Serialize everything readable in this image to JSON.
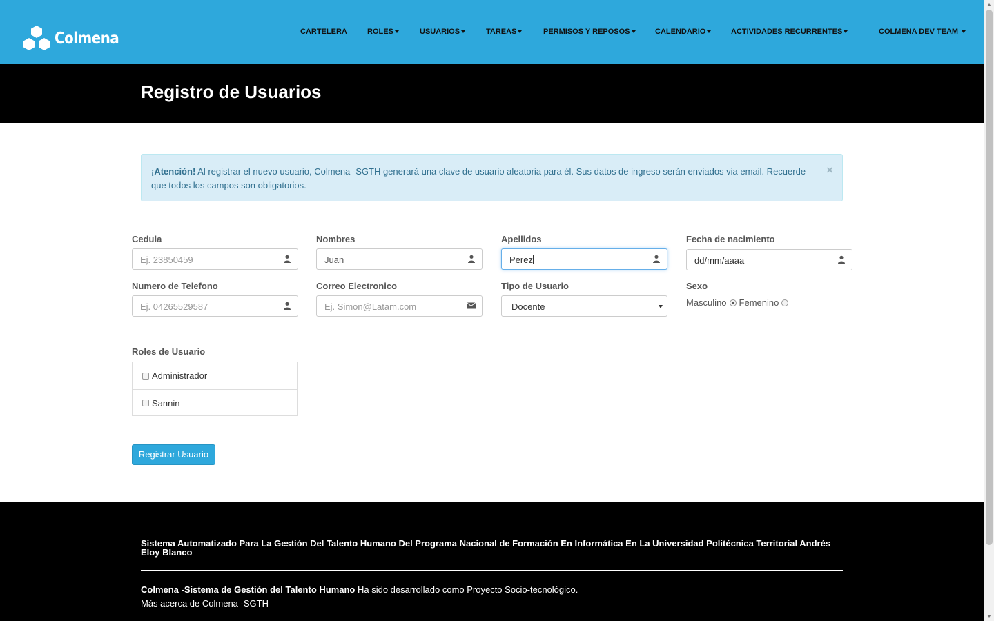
{
  "brand": {
    "name": "Colmena"
  },
  "nav": {
    "items": [
      {
        "label": "CARTELERA",
        "dropdown": false
      },
      {
        "label": "ROLES",
        "dropdown": true
      },
      {
        "label": "USUARIOS",
        "dropdown": true
      },
      {
        "label": "TAREAS",
        "dropdown": true
      },
      {
        "label": "PERMISOS Y REPOSOS",
        "dropdown": true
      },
      {
        "label": "CALENDARIO",
        "dropdown": true
      },
      {
        "label": "ACTIVIDADES RECURRENTES",
        "dropdown": true
      }
    ],
    "user": {
      "label": "COLMENA DEV TEAM",
      "dropdown": true
    }
  },
  "header": {
    "title": "Registro de Usuarios"
  },
  "alert": {
    "strong": "¡Atención!",
    "text": " Al registrar el nuevo usuario, Colmena -SGTH generará una clave de usuario aleatoria para él. Sus datos de ingreso serán enviados via email. Recuerde que todos los campos son obligatorios.",
    "close": "×"
  },
  "form": {
    "cedula": {
      "label": "Cedula",
      "placeholder": "Ej. 23850459",
      "value": "",
      "icon": "user-icon"
    },
    "nombres": {
      "label": "Nombres",
      "placeholder": "",
      "value": "Juan",
      "icon": "user-icon"
    },
    "apellidos": {
      "label": "Apellidos",
      "placeholder": "",
      "value": "Perez",
      "icon": "user-icon"
    },
    "fecha": {
      "label": "Fecha de nacimiento",
      "placeholder": "",
      "value": "dd/mm/aaaa",
      "icon": "user-icon"
    },
    "telefono": {
      "label": "Numero de Telefono",
      "placeholder": "Ej. 04265529587",
      "value": "",
      "icon": "user-icon"
    },
    "correo": {
      "label": "Correo Electronico",
      "placeholder": "Ej. Simon@Latam.com",
      "value": "",
      "icon": "envelope-icon"
    },
    "tipo": {
      "label": "Tipo de Usuario",
      "value": "Docente"
    },
    "sexo": {
      "label": "Sexo",
      "options": [
        "Masculino",
        "Femenino"
      ],
      "selected": "Masculino"
    },
    "roles": {
      "label": "Roles de Usuario",
      "items": [
        "Administrador",
        "Sannin"
      ]
    },
    "submit": "Registrar Usuario"
  },
  "footer": {
    "title": "Sistema Automatizado Para La Gestión Del Talento Humano Del Programa Nacional de Formación En Informática En La Universidad Politécnica Territorial Andrés Eloy Blanco",
    "line1_strong": "Colmena -Sistema de Gestión del Talento Humano",
    "line1_text": " Ha sido desarrollado como Proyecto Socio-tecnológico.",
    "line2": "Más acerca de Colmena -SGTH"
  },
  "colors": {
    "navbar": "#2ea8dc",
    "header": "#000000",
    "alert_bg": "#d9edf7",
    "alert_text": "#31708f",
    "button": "#2ea8dc"
  }
}
